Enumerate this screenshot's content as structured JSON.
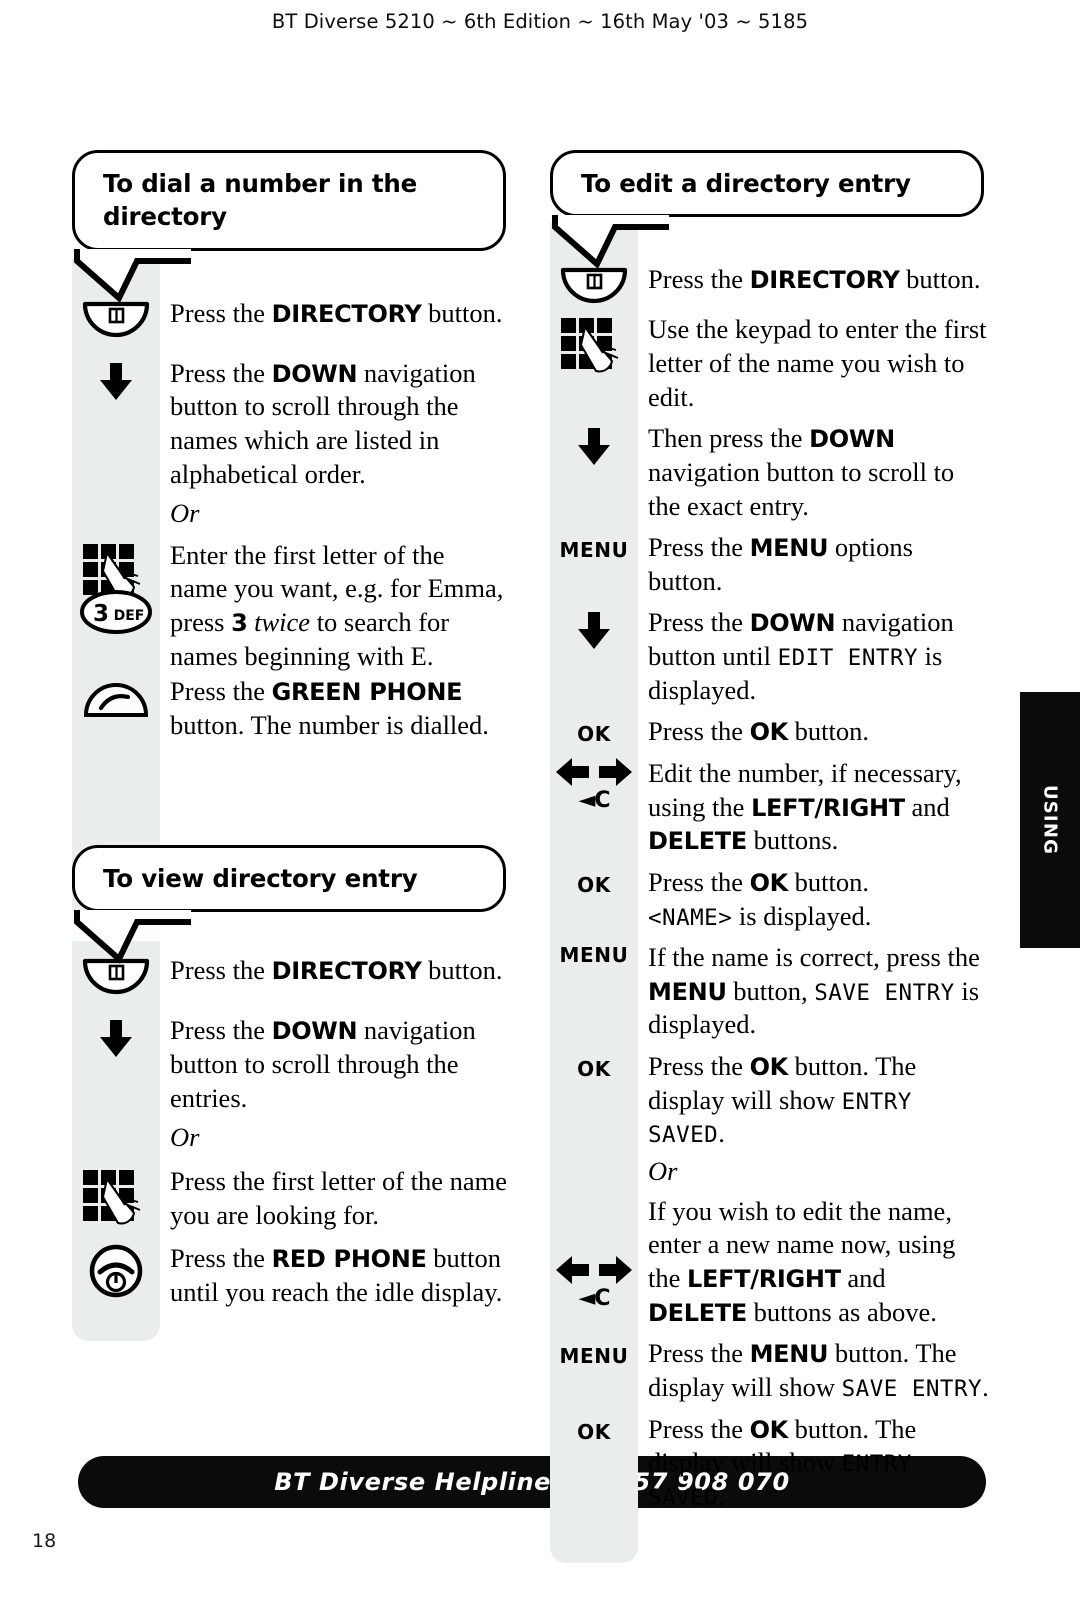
{
  "header": {
    "title": "BT Diverse 5210 ~ 6th Edition ~ 16th May '03 ~ 5185"
  },
  "side_tab": {
    "label": "USING"
  },
  "footer": {
    "helpline": "BT Diverse Helpline – 08457 908 070",
    "page_number": "18"
  },
  "sections": [
    {
      "id": "dial-a-number",
      "heading": "To dial a number in the directory",
      "steps": [
        {
          "icon": "directory-button-icon",
          "text_html": "Press the <b>DIRECTORY</b> button."
        },
        {
          "icon": "down-arrow-icon",
          "text_html": "Press the <b>DOWN</b> navigation button to scroll through the names which are listed in alphabetical order."
        },
        {
          "icon": "none",
          "text_html": "<i>Or</i>"
        },
        {
          "icon": "keypad-icon",
          "text_html": "Enter the first letter of the name you want, e.g. for Emma, press <b>3</b> <i>twice</i> to search for names beginning with E."
        },
        {
          "icon": "key-3-def-icon",
          "text_html": ""
        },
        {
          "icon": "green-phone-icon",
          "text_html": "Press the <b>GREEN PHONE</b> button. The number is dialled."
        }
      ]
    },
    {
      "id": "view-directory-entry",
      "heading": "To view directory entry",
      "steps": [
        {
          "icon": "directory-button-icon",
          "text_html": "Press the <b>DIRECTORY</b> button."
        },
        {
          "icon": "down-arrow-icon",
          "text_html": "Press the <b>DOWN</b> navigation button to scroll through the entries."
        },
        {
          "icon": "none",
          "text_html": "<i>Or</i>"
        },
        {
          "icon": "keypad-icon",
          "text_html": "Press the first letter of the name you are looking for."
        },
        {
          "icon": "red-phone-icon",
          "text_html": "Press the <b>RED PHONE</b> button until you reach the idle display."
        }
      ]
    },
    {
      "id": "edit-directory-entry",
      "heading": "To edit a directory entry",
      "steps": [
        {
          "icon": "directory-button-icon",
          "text_html": "Press the <b>DIRECTORY</b> button."
        },
        {
          "icon": "keypad-icon",
          "text_html": "Use the keypad to enter the first letter of the name you wish to edit."
        },
        {
          "icon": "down-arrow-icon",
          "text_html": "Then press the <b>DOWN</b> navigation button to scroll to the exact entry."
        },
        {
          "icon": "menu-label-icon",
          "text_html": "Press the <b>MENU</b> options button."
        },
        {
          "icon": "down-arrow-icon",
          "text_html": "Press the <b>DOWN</b> navigation button until <span class=\"lcd\">EDIT ENTRY</span> is displayed."
        },
        {
          "icon": "ok-label-icon",
          "text_html": "Press the <b>OK</b> button."
        },
        {
          "icon": "left-right-delete-icon",
          "text_html": "Edit the number, if necessary, using the <b>LEFT/RIGHT</b> and <b>DELETE</b> buttons."
        },
        {
          "icon": "ok-label-icon",
          "text_html": "Press the <b>OK</b> button.<br><span class=\"lcd\">&lt;NAME&gt;</span> is displayed."
        },
        {
          "icon": "menu-label-icon",
          "text_html": "If the name is correct, press the <b>MENU</b> button, <span class=\"lcd\">SAVE ENTRY</span> is displayed."
        },
        {
          "icon": "ok-label-icon",
          "text_html": "Press the <b>OK</b> button. The display will show <span class=\"lcd\">ENTRY SAVED</span>."
        },
        {
          "icon": "none",
          "text_html": "<i>Or</i>"
        },
        {
          "icon": "left-right-delete-icon",
          "text_html": "If you wish to edit the name, enter a new name now, using the <b>LEFT/RIGHT</b> and <b>DELETE</b> buttons as above."
        },
        {
          "icon": "menu-label-icon",
          "text_html": "Press the <b>MENU</b> button. The display will show <span class=\"lcd\">SAVE ENTRY</span>."
        },
        {
          "icon": "ok-label-icon",
          "text_html": "Press the <b>OK</b> button. The display will show <span class=\"lcd\">ENTRY SAVED</span>."
        }
      ]
    }
  ],
  "icon_labels": {
    "menu": "MENU",
    "ok": "OK",
    "delete": "◄C",
    "key_3": "3",
    "key_3_letters": "DEF"
  },
  "colors": {
    "gutter_grey": "#e9eeec",
    "ink_black": "#0b0b0b",
    "paper_white": "#ffffff"
  }
}
